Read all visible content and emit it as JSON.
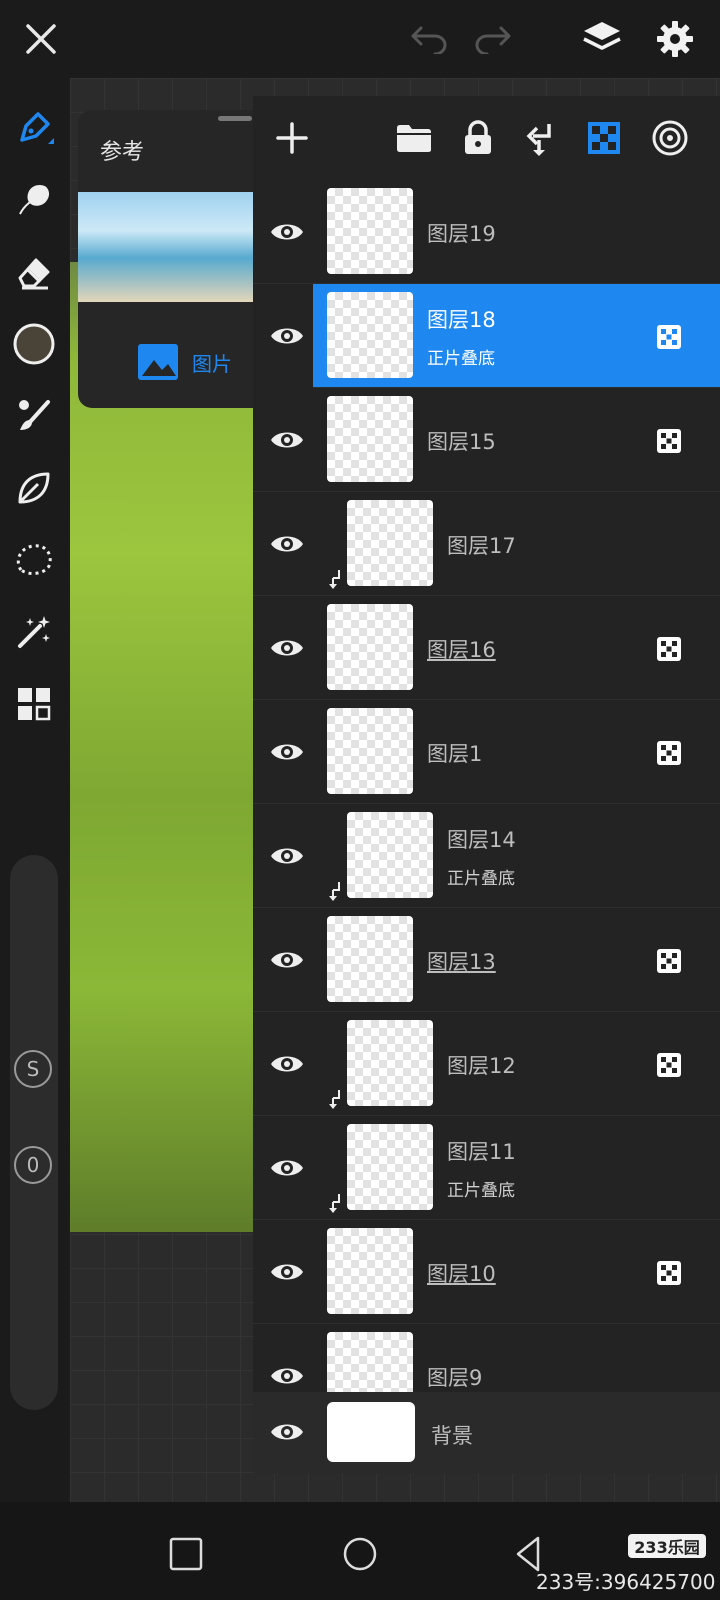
{
  "reference_panel": {
    "title": "参考",
    "mode_label": "图片"
  },
  "layers": [
    {
      "name": "图层19",
      "blend": "",
      "selected": false,
      "clipped": false,
      "alpha_lock": false,
      "underlined": false
    },
    {
      "name": "图层18",
      "blend": "正片叠底",
      "selected": true,
      "clipped": false,
      "alpha_lock": true,
      "underlined": false
    },
    {
      "name": "图层15",
      "blend": "",
      "selected": false,
      "clipped": false,
      "alpha_lock": true,
      "underlined": false
    },
    {
      "name": "图层17",
      "blend": "",
      "selected": false,
      "clipped": true,
      "alpha_lock": false,
      "underlined": false
    },
    {
      "name": "图层16",
      "blend": "",
      "selected": false,
      "clipped": false,
      "alpha_lock": true,
      "underlined": true
    },
    {
      "name": "图层1",
      "blend": "",
      "selected": false,
      "clipped": false,
      "alpha_lock": true,
      "underlined": false
    },
    {
      "name": "图层14",
      "blend": "正片叠底",
      "selected": false,
      "clipped": true,
      "alpha_lock": false,
      "underlined": false
    },
    {
      "name": "图层13",
      "blend": "",
      "selected": false,
      "clipped": false,
      "alpha_lock": true,
      "underlined": true
    },
    {
      "name": "图层12",
      "blend": "",
      "selected": false,
      "clipped": true,
      "alpha_lock": true,
      "underlined": false
    },
    {
      "name": "图层11",
      "blend": "正片叠底",
      "selected": false,
      "clipped": true,
      "alpha_lock": false,
      "underlined": false
    },
    {
      "name": "图层10",
      "blend": "",
      "selected": false,
      "clipped": false,
      "alpha_lock": true,
      "underlined": true
    },
    {
      "name": "图层9",
      "blend": "",
      "selected": false,
      "clipped": false,
      "alpha_lock": false,
      "underlined": false
    }
  ],
  "background_layer": {
    "name": "背景"
  },
  "watermark": {
    "logo": "233乐园",
    "id": "233号:396425700"
  },
  "colors": {
    "accent": "#1e88f0",
    "current_color": "#4a4438"
  }
}
